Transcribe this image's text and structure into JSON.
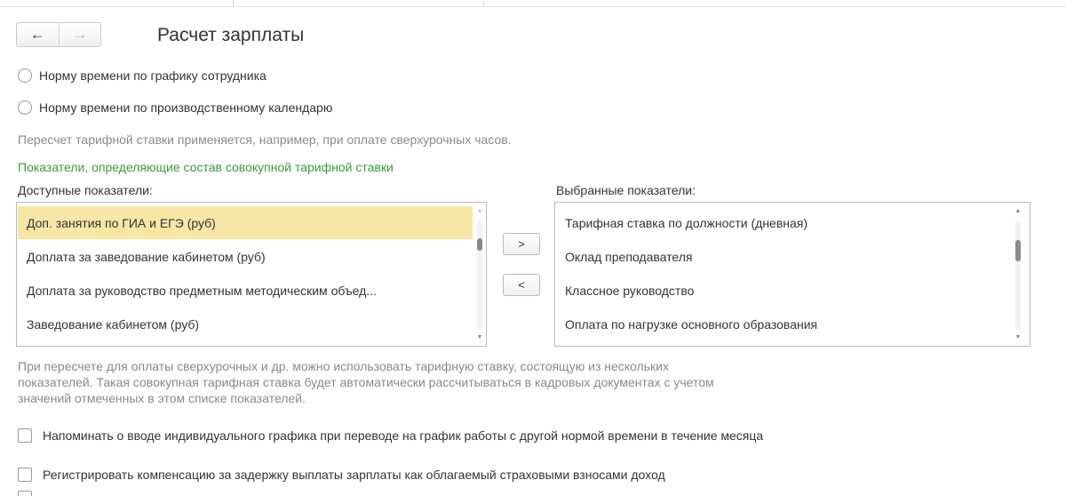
{
  "header": {
    "title": "Расчет зарплаты",
    "back_icon": "←",
    "forward_icon": "→"
  },
  "radio_options": [
    {
      "label": "Норму времени по графику сотрудника",
      "selected": false
    },
    {
      "label": "Норму времени по производственному календарю",
      "selected": false
    }
  ],
  "recalc_note": "Пересчет тарифной ставки применяется, например, при оплате сверхурочных часов.",
  "indicators": {
    "section_title": "Показатели, определяющие состав совокупной тарифной ставки",
    "available": {
      "caption": "Доступные показатели:",
      "items": [
        "Доп. занятия по ГИА и ЕГЭ (руб)",
        "Доплата за заведование кабинетом (руб)",
        "Доплата за руководство предметным методическим объед...",
        "Заведование кабинетом (руб)"
      ],
      "selected_index": 0
    },
    "selected": {
      "caption": "Выбранные показатели:",
      "items": [
        "Тарифная ставка по должности (дневная)",
        "Оклад преподавателя",
        "Классное руководство",
        "Оплата по нагрузке основного образования"
      ]
    },
    "add_button": ">",
    "remove_button": "<"
  },
  "composite_note": {
    "line1": "При пересчете для оплаты сверхурочных и др. можно использовать тарифную ставку, состоящую из нескольких",
    "line2": "показателей. Такая совокупная тарифная ставка будет автоматически рассчитываться в кадровых документах с учетом",
    "line3": "значений отмеченных в этом списке показателей."
  },
  "checkboxes": [
    {
      "label": "Напоминать о вводе индивидуального графика при переводе на график работы с другой нормой времени в течение месяца",
      "checked": false
    },
    {
      "label": "Регистрировать компенсацию за задержку выплаты зарплаты как облагаемый страховыми взносами доход",
      "checked": false
    }
  ],
  "scroll_icons": {
    "up": "▲",
    "down": "▼"
  },
  "colors": {
    "section_title": "#3e9a3e",
    "selected_row": "#f7e6a5",
    "note_text": "#8a8a8a"
  }
}
